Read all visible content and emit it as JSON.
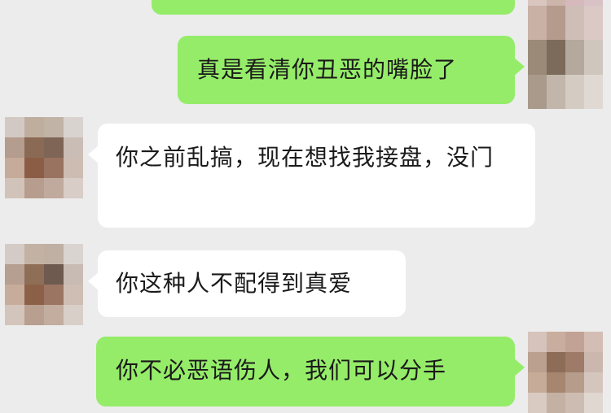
{
  "chat": {
    "messages": [
      {
        "sender": "self",
        "text": ""
      },
      {
        "sender": "self",
        "text": "真是看清你丑恶的嘴脸了"
      },
      {
        "sender": "other",
        "text": "你之前乱搞，现在想找我接盘，没门"
      },
      {
        "sender": "other",
        "text": "你这种人不配得到真爱"
      },
      {
        "sender": "self",
        "text": "你不必恶语伤人，我们可以分手"
      }
    ]
  },
  "colors": {
    "background": "#ececec",
    "self_bubble": "#95ec69",
    "other_bubble": "#ffffff",
    "text": "#1a1a1a"
  }
}
